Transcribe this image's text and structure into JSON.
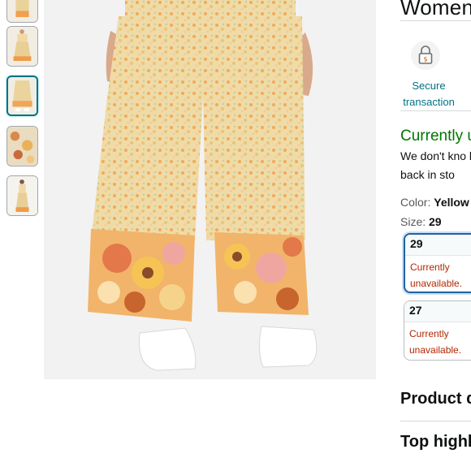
{
  "thumbnails": [
    {
      "name": "thumb-1",
      "selected": false
    },
    {
      "name": "thumb-2",
      "selected": false
    },
    {
      "name": "thumb-3",
      "selected": true
    },
    {
      "name": "thumb-4",
      "selected": false
    },
    {
      "name": "thumb-5",
      "selected": false
    }
  ],
  "product": {
    "title": "Women"
  },
  "secure": {
    "label": "Secure transaction",
    "icon": "lock-icon"
  },
  "availability": {
    "status": "Currently u",
    "note": "We don't kno be back in sto"
  },
  "color": {
    "label": "Color:",
    "value": "Yellow"
  },
  "size": {
    "label": "Size:",
    "value": "29",
    "options": [
      {
        "size": "29",
        "status": "Currently unavailable.",
        "selected": true
      },
      {
        "size": "27",
        "status": "Currently unavailable.",
        "selected": false
      }
    ]
  },
  "sections": {
    "product_details": "Product d",
    "top_highlights": "Top highli"
  },
  "colors": {
    "link": "#007185",
    "in_stock": "#007600",
    "unavailable": "#b12704",
    "selected_border": "#2162a1"
  }
}
